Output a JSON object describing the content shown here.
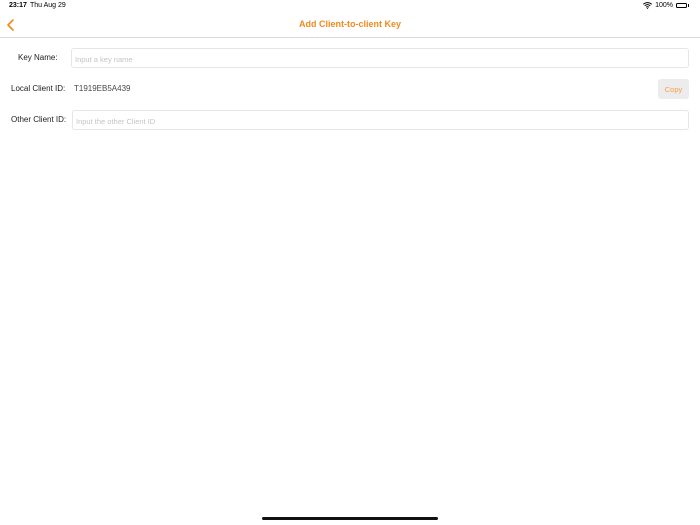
{
  "status_bar": {
    "time": "23:17",
    "date": "Thu Aug 29",
    "battery_percent": "100%",
    "battery_level": 1.0,
    "wifi_icon": "wifi-icon",
    "battery_icon": "battery-icon"
  },
  "nav": {
    "title": "Add Client-to-client Key",
    "back_icon": "chevron-left-icon",
    "accent_color": "#F08A1C"
  },
  "form": {
    "key_name": {
      "label": "Key Name:",
      "value": "",
      "placeholder": "Input a key name"
    },
    "local_client_id": {
      "label": "Local Client ID:",
      "value": "T1919EB5A439",
      "copy_label": "Copy"
    },
    "other_client_id": {
      "label": "Other Client ID:",
      "value": "",
      "placeholder": "Input the other Client ID"
    }
  }
}
